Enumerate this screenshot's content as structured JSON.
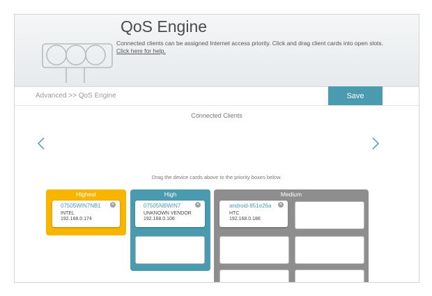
{
  "header": {
    "title": "QoS Engine",
    "description": "Connected clients can be assigned Internet access priority. Click and drag client cards into open slots.",
    "help_link": "Click here for help."
  },
  "breadcrumb": "Advanced >> QoS Engine",
  "save_label": "Save",
  "connected_title": "Connected Clients",
  "drag_text": "Drag the device cards above to the priority boxes below.",
  "colors": {
    "accent": "#4a9bb0",
    "highest": "#f7b500",
    "high": "#4a9bb0",
    "medium": "#8e8e8e"
  },
  "priority_boxes": [
    {
      "label": "Highest",
      "cards": [
        {
          "name": "07505WIN7NB1",
          "vendor": "INTEL",
          "ip": "192.168.0.174"
        }
      ]
    },
    {
      "label": "High",
      "cards": [
        {
          "name": "07505NBWIN7",
          "vendor": "UNKNOWN VENDOR",
          "ip": "192.168.0.106"
        }
      ]
    },
    {
      "label": "Medium",
      "cards": [
        {
          "name": "android-851e26a",
          "vendor": "HTC",
          "ip": "192.168.0.186"
        }
      ]
    }
  ]
}
